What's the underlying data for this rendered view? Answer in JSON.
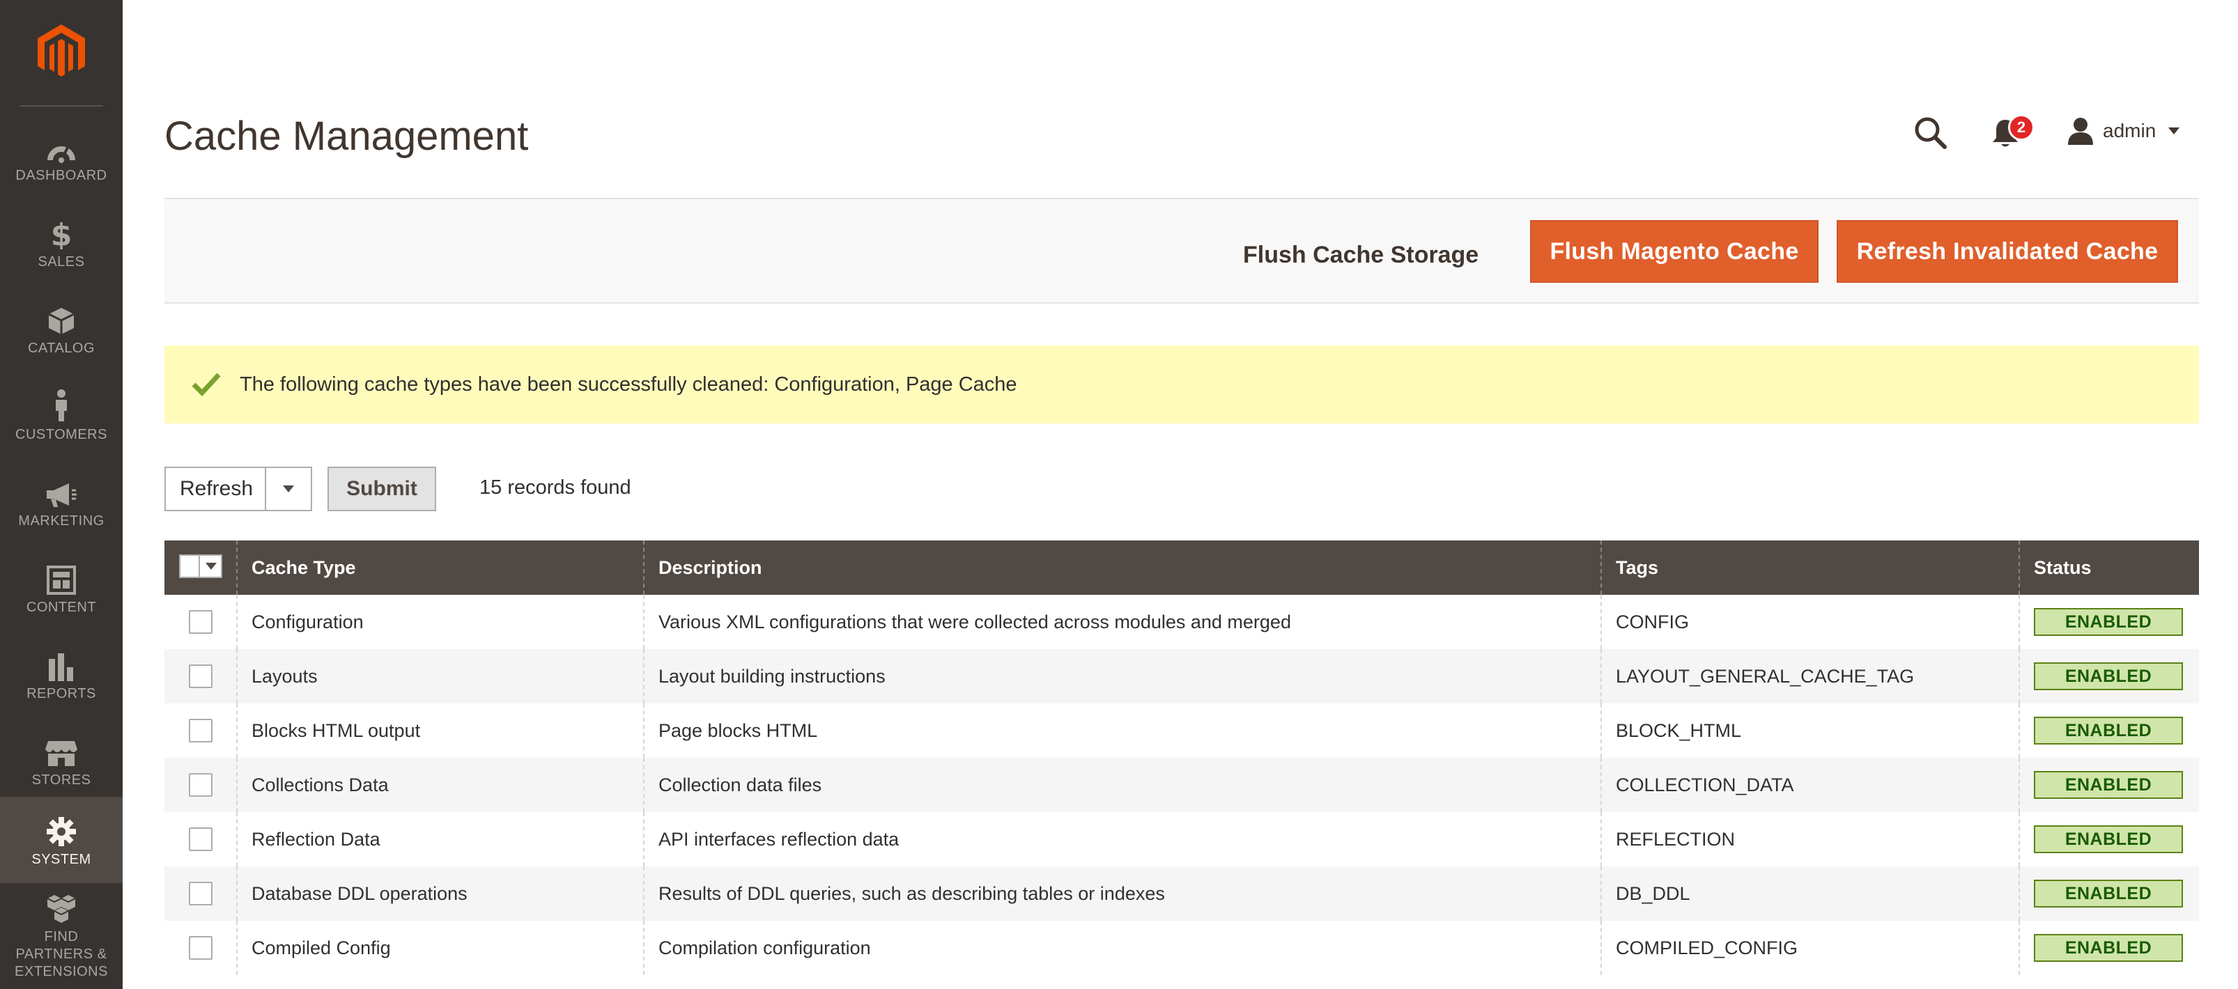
{
  "nav": {
    "items": [
      {
        "label": "DASHBOARD",
        "icon": "dashboard-icon"
      },
      {
        "label": "SALES",
        "icon": "dollar-icon"
      },
      {
        "label": "CATALOG",
        "icon": "box-icon"
      },
      {
        "label": "CUSTOMERS",
        "icon": "person-icon"
      },
      {
        "label": "MARKETING",
        "icon": "megaphone-icon"
      },
      {
        "label": "CONTENT",
        "icon": "layout-icon"
      },
      {
        "label": "REPORTS",
        "icon": "bar-chart-icon"
      },
      {
        "label": "STORES",
        "icon": "storefront-icon"
      },
      {
        "label": "SYSTEM",
        "icon": "gear-icon",
        "active": true
      },
      {
        "label": "FIND PARTNERS & EXTENSIONS",
        "icon": "extensions-icon"
      }
    ]
  },
  "header": {
    "title": "Cache Management",
    "notifications_count": "2",
    "user_name": "admin"
  },
  "actions": {
    "flush_storage": "Flush Cache Storage",
    "flush_magento": "Flush Magento Cache",
    "refresh_invalidated": "Refresh Invalidated Cache"
  },
  "message": {
    "text": "The following cache types have been successfully cleaned: Configuration, Page Cache"
  },
  "grid_controls": {
    "mass_action": "Refresh",
    "submit": "Submit",
    "records": "15 records found"
  },
  "table": {
    "columns": [
      "Cache Type",
      "Description",
      "Tags",
      "Status"
    ],
    "rows": [
      {
        "type": "Configuration",
        "description": "Various XML configurations that were collected across modules and merged",
        "tags": "CONFIG",
        "status": "ENABLED"
      },
      {
        "type": "Layouts",
        "description": "Layout building instructions",
        "tags": "LAYOUT_GENERAL_CACHE_TAG",
        "status": "ENABLED"
      },
      {
        "type": "Blocks HTML output",
        "description": "Page blocks HTML",
        "tags": "BLOCK_HTML",
        "status": "ENABLED"
      },
      {
        "type": "Collections Data",
        "description": "Collection data files",
        "tags": "COLLECTION_DATA",
        "status": "ENABLED"
      },
      {
        "type": "Reflection Data",
        "description": "API interfaces reflection data",
        "tags": "REFLECTION",
        "status": "ENABLED"
      },
      {
        "type": "Database DDL operations",
        "description": "Results of DDL queries, such as describing tables or indexes",
        "tags": "DB_DDL",
        "status": "ENABLED"
      },
      {
        "type": "Compiled Config",
        "description": "Compilation configuration",
        "tags": "COMPILED_CONFIG",
        "status": "ENABLED"
      }
    ]
  },
  "colors": {
    "nav_bg": "#373330",
    "nav_active": "#514943",
    "accent": "#e05f2b",
    "message_bg": "#fffbbb",
    "success": "#79a22e",
    "status_badge_bg": "#d0e5a9"
  }
}
